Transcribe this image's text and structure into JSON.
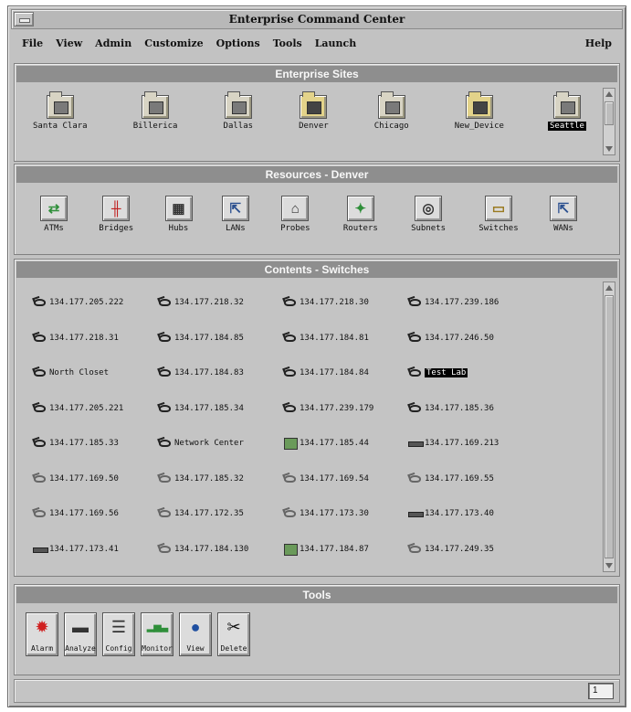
{
  "window": {
    "title": "Enterprise Command Center"
  },
  "menubar": {
    "items": [
      "File",
      "View",
      "Admin",
      "Customize",
      "Options",
      "Tools",
      "Launch"
    ],
    "help": "Help"
  },
  "sites": {
    "header": "Enterprise Sites",
    "items": [
      {
        "label": "Santa Clara",
        "icon": "building-folder-icon",
        "style": "plain",
        "selected": false
      },
      {
        "label": "Billerica",
        "icon": "building-folder-icon",
        "style": "plain",
        "selected": false
      },
      {
        "label": "Dallas",
        "icon": "building-folder-icon",
        "style": "plain",
        "selected": false
      },
      {
        "label": "Denver",
        "icon": "open-folder-icon",
        "style": "yellow",
        "selected": false
      },
      {
        "label": "Chicago",
        "icon": "building-folder-icon",
        "style": "plain",
        "selected": false
      },
      {
        "label": "New_Device",
        "icon": "device-folder-icon",
        "style": "yellow",
        "selected": false
      },
      {
        "label": "Seattle",
        "icon": "building-folder-icon",
        "style": "plain",
        "selected": true
      }
    ]
  },
  "resources": {
    "header": "Resources - Denver",
    "items": [
      {
        "label": "ATMs",
        "icon": "atm-icon",
        "glyph": "⇄",
        "color": "#2f8f3a"
      },
      {
        "label": "Bridges",
        "icon": "bridge-icon",
        "glyph": "╫",
        "color": "#c02020"
      },
      {
        "label": "Hubs",
        "icon": "hub-icon",
        "glyph": "▦",
        "color": "#333333"
      },
      {
        "label": "LANs",
        "icon": "lan-icon",
        "glyph": "⇱",
        "color": "#2a4f8f"
      },
      {
        "label": "Probes",
        "icon": "probe-icon",
        "glyph": "⌂",
        "color": "#333333"
      },
      {
        "label": "Routers",
        "icon": "router-icon",
        "glyph": "✦",
        "color": "#2f8f3a"
      },
      {
        "label": "Subnets",
        "icon": "subnet-icon",
        "glyph": "◎",
        "color": "#333333"
      },
      {
        "label": "Switches",
        "icon": "switch-folder-icon",
        "glyph": "▭",
        "color": "#9a7a20"
      },
      {
        "label": "WANs",
        "icon": "wan-icon",
        "glyph": "⇱",
        "color": "#2a4f8f"
      }
    ]
  },
  "contents": {
    "header": "Contents - Switches",
    "items": [
      {
        "text": "134.177.205.222",
        "icon": "phone",
        "selected": false
      },
      {
        "text": "134.177.218.32",
        "icon": "phone",
        "selected": false
      },
      {
        "text": "134.177.218.30",
        "icon": "phone",
        "selected": false
      },
      {
        "text": "134.177.239.186",
        "icon": "phone",
        "selected": false
      },
      {
        "text": "134.177.218.31",
        "icon": "phone",
        "selected": false
      },
      {
        "text": "134.177.184.85",
        "icon": "phone",
        "selected": false
      },
      {
        "text": "134.177.184.81",
        "icon": "phone",
        "selected": false
      },
      {
        "text": "134.177.246.50",
        "icon": "phone",
        "selected": false
      },
      {
        "text": "North Closet",
        "icon": "phone",
        "selected": false
      },
      {
        "text": "134.177.184.83",
        "icon": "phone",
        "selected": false
      },
      {
        "text": "134.177.184.84",
        "icon": "phone",
        "selected": false
      },
      {
        "text": "Test Lab",
        "icon": "phone",
        "selected": true
      },
      {
        "text": "134.177.205.221",
        "icon": "phone",
        "selected": false
      },
      {
        "text": "134.177.185.34",
        "icon": "phone",
        "selected": false
      },
      {
        "text": "134.177.239.179",
        "icon": "phone",
        "selected": false
      },
      {
        "text": "134.177.185.36",
        "icon": "phone",
        "selected": false
      },
      {
        "text": "134.177.185.33",
        "icon": "phone",
        "selected": false
      },
      {
        "text": "Network Center",
        "icon": "phone",
        "selected": false
      },
      {
        "text": "134.177.185.44",
        "icon": "box",
        "selected": false
      },
      {
        "text": "134.177.169.213",
        "icon": "bar",
        "selected": false
      },
      {
        "text": "134.177.169.50",
        "icon": "light",
        "selected": false
      },
      {
        "text": "134.177.185.32",
        "icon": "light",
        "selected": false
      },
      {
        "text": "134.177.169.54",
        "icon": "light",
        "selected": false
      },
      {
        "text": "134.177.169.55",
        "icon": "light",
        "selected": false
      },
      {
        "text": "134.177.169.56",
        "icon": "light",
        "selected": false
      },
      {
        "text": "134.177.172.35",
        "icon": "light",
        "selected": false
      },
      {
        "text": "134.177.173.30",
        "icon": "light",
        "selected": false
      },
      {
        "text": "134.177.173.40",
        "icon": "bar",
        "selected": false
      },
      {
        "text": "134.177.173.41",
        "icon": "bar",
        "selected": false
      },
      {
        "text": "134.177.184.130",
        "icon": "light",
        "selected": false
      },
      {
        "text": "134.177.184.87",
        "icon": "box",
        "selected": false
      },
      {
        "text": "134.177.249.35",
        "icon": "light",
        "selected": false
      }
    ]
  },
  "tools": {
    "header": "Tools",
    "items": [
      {
        "label": "Alarm",
        "icon": "alarm-icon",
        "glyph": "✹",
        "color": "#d02020"
      },
      {
        "label": "Analyze",
        "icon": "analyze-icon",
        "glyph": "▬",
        "color": "#333333"
      },
      {
        "label": "Config",
        "icon": "config-icon",
        "glyph": "☰",
        "color": "#333333"
      },
      {
        "label": "Monitor",
        "icon": "monitor-icon",
        "glyph": "▂▅▃",
        "color": "#2f8f3a"
      },
      {
        "label": "View",
        "icon": "globe-icon",
        "glyph": "●",
        "color": "#1f4fa0"
      },
      {
        "label": "Delete",
        "icon": "scissors-icon",
        "glyph": "✂",
        "color": "#111111"
      }
    ]
  },
  "status": {
    "page": "1"
  }
}
